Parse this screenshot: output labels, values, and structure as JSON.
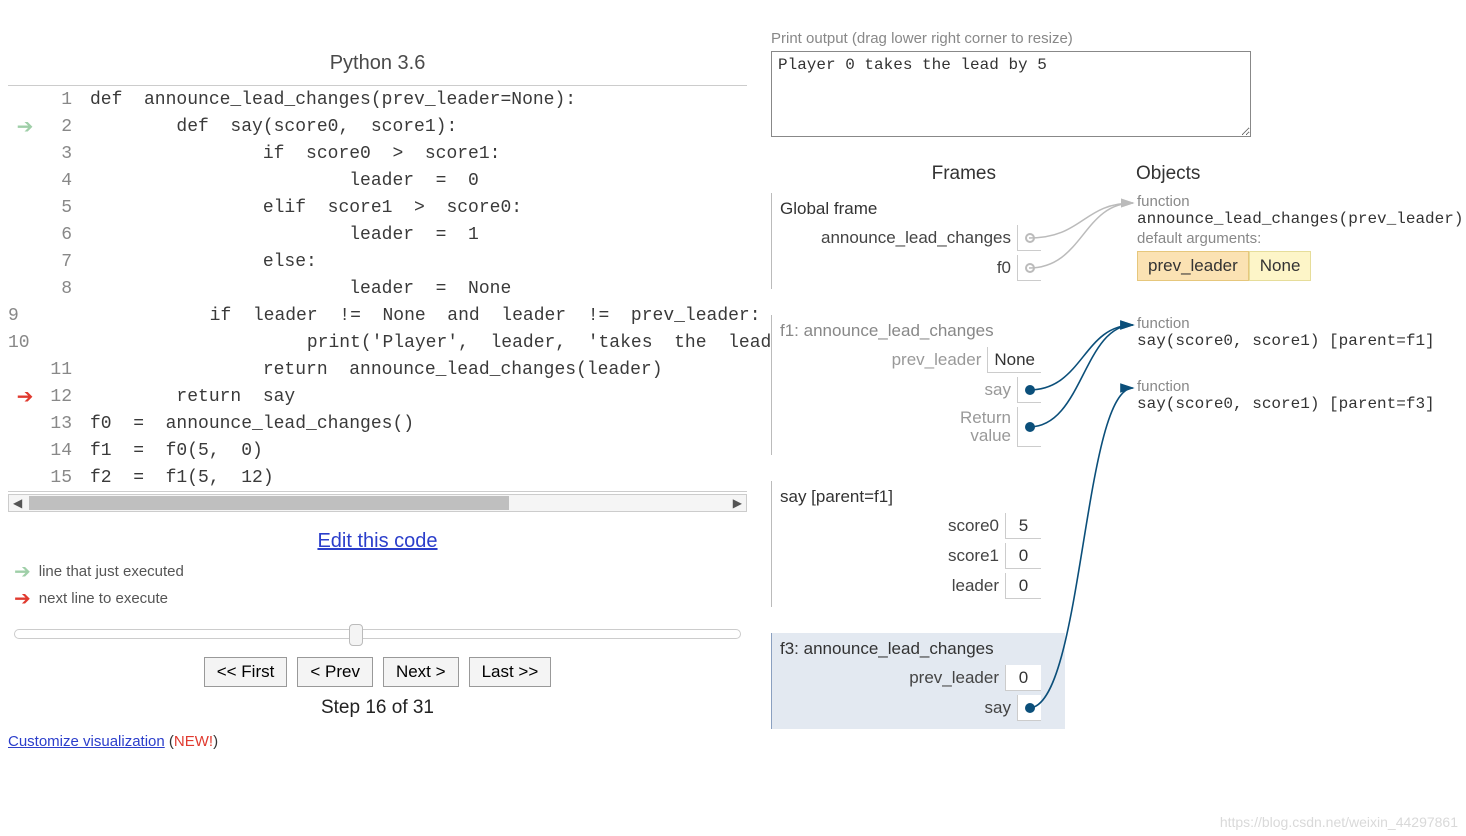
{
  "lang_title": "Python 3.6",
  "code_lines": [
    {
      "n": 1,
      "text": "def  announce_lead_changes(prev_leader=None):",
      "marker": ""
    },
    {
      "n": 2,
      "text": "        def  say(score0,  score1):",
      "marker": "exec"
    },
    {
      "n": 3,
      "text": "                if  score0  >  score1:",
      "marker": ""
    },
    {
      "n": 4,
      "text": "                        leader  =  0",
      "marker": ""
    },
    {
      "n": 5,
      "text": "                elif  score1  >  score0:",
      "marker": ""
    },
    {
      "n": 6,
      "text": "                        leader  =  1",
      "marker": ""
    },
    {
      "n": 7,
      "text": "                else:",
      "marker": ""
    },
    {
      "n": 8,
      "text": "                        leader  =  None",
      "marker": ""
    },
    {
      "n": 9,
      "text": "                if  leader  !=  None  and  leader  !=  prev_leader:",
      "marker": ""
    },
    {
      "n": 10,
      "text": "                        print('Player',  leader,  'takes  the  lead",
      "marker": ""
    },
    {
      "n": 11,
      "text": "                return  announce_lead_changes(leader)",
      "marker": ""
    },
    {
      "n": 12,
      "text": "        return  say",
      "marker": "next"
    },
    {
      "n": 13,
      "text": "f0  =  announce_lead_changes()",
      "marker": ""
    },
    {
      "n": 14,
      "text": "f1  =  f0(5,  0)",
      "marker": ""
    },
    {
      "n": 15,
      "text": "f2  =  f1(5,  12)",
      "marker": ""
    }
  ],
  "edit_link": "Edit this code",
  "legend_exec": "line that just executed",
  "legend_next": "next line to execute",
  "nav": {
    "first": "<< First",
    "prev": "< Prev",
    "next": "Next >",
    "last": "Last >>"
  },
  "step_text": "Step 16 of 31",
  "customize_link": "Customize visualization",
  "customize_new": "NEW!",
  "output_label": "Print output (drag lower right corner to resize)",
  "output_text": "Player 0 takes the lead by 5",
  "headers": {
    "frames": "Frames",
    "objects": "Objects"
  },
  "frames": {
    "global": {
      "title": "Global frame",
      "rows": [
        {
          "k": "announce_lead_changes",
          "v": "",
          "dot": "open"
        },
        {
          "k": "f0",
          "v": "",
          "dot": "open"
        }
      ]
    },
    "f1": {
      "title": "f1: announce_lead_changes",
      "rows": [
        {
          "k": "prev_leader",
          "v": "None"
        },
        {
          "k": "say",
          "v": "",
          "dot": "full"
        },
        {
          "k": "Return value",
          "v": "",
          "dot": "full",
          "multiline": true
        }
      ]
    },
    "say": {
      "title": "say [parent=f1]",
      "rows": [
        {
          "k": "score0",
          "v": "5"
        },
        {
          "k": "score1",
          "v": "0"
        },
        {
          "k": "leader",
          "v": "0"
        }
      ]
    },
    "f3": {
      "title": "f3: announce_lead_changes",
      "rows": [
        {
          "k": "prev_leader",
          "v": "0"
        },
        {
          "k": "say",
          "v": "",
          "dot": "full"
        }
      ]
    }
  },
  "objects": {
    "o1": {
      "label": "function",
      "sig": "announce_lead_changes(prev_leader)",
      "defarg_label": "default arguments:",
      "defarg_k": "prev_leader",
      "defarg_v": "None"
    },
    "o2": {
      "label": "function",
      "sig": "say(score0,  score1) [parent=f1]"
    },
    "o3": {
      "label": "function",
      "sig": "say(score0,  score1) [parent=f3]"
    }
  },
  "watermark": "https://blog.csdn.net/weixin_44297861"
}
